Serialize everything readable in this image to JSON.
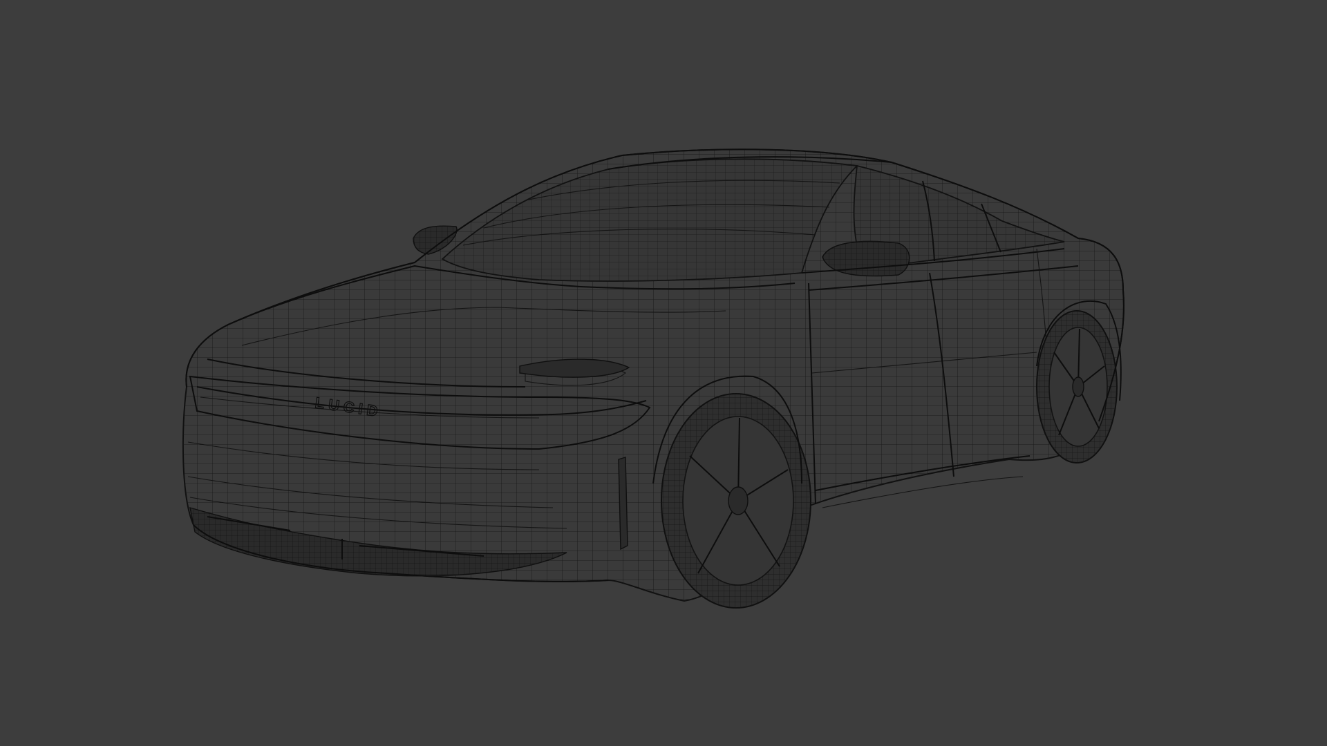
{
  "viewport": {
    "background_color": "#3d3d3d",
    "wire_color": "#141414"
  },
  "model": {
    "badge_text": "LUCID"
  }
}
